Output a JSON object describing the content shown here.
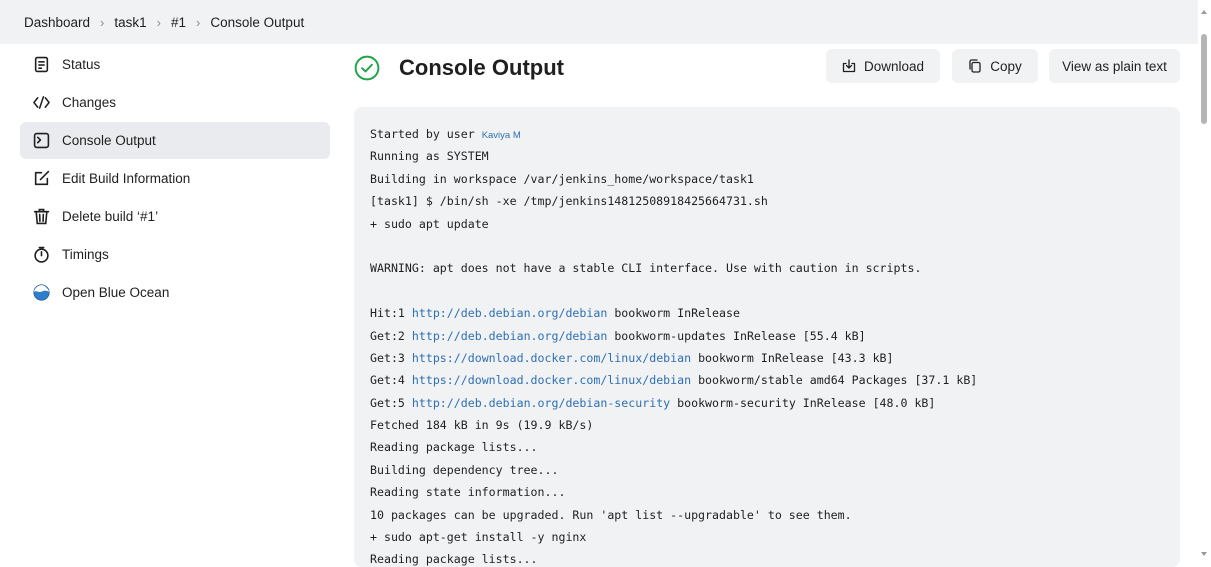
{
  "breadcrumb": {
    "items": [
      "Dashboard",
      "task1",
      "#1",
      "Console Output"
    ],
    "separator": "›"
  },
  "sidebar": {
    "items": [
      {
        "label": "Status",
        "icon": "document-icon"
      },
      {
        "label": "Changes",
        "icon": "code-icon"
      },
      {
        "label": "Console Output",
        "icon": "terminal-icon",
        "active": true
      },
      {
        "label": "Edit Build Information",
        "icon": "edit-icon"
      },
      {
        "label": "Delete build ‘#1’",
        "icon": "trash-icon"
      },
      {
        "label": "Timings",
        "icon": "stopwatch-icon"
      },
      {
        "label": "Open Blue Ocean",
        "icon": "blue-ocean-icon"
      }
    ]
  },
  "header": {
    "title": "Console Output",
    "status_icon": "success-check-icon",
    "download_label": "Download",
    "copy_label": "Copy",
    "plain_text_label": "View as plain text"
  },
  "console": {
    "started_prefix": "Started by user ",
    "started_user": "Kaviya M",
    "line_running": "Running as SYSTEM",
    "line_workspace": "Building in workspace /var/jenkins_home/workspace/task1",
    "line_script": "[task1] $ /bin/sh -xe /tmp/jenkins14812508918425664731.sh",
    "line_apt_update": "+ sudo apt update",
    "line_warning": "WARNING: apt does not have a stable CLI interface. Use with caution in scripts.",
    "hits": [
      {
        "prefix": "Hit:1 ",
        "url": "http://deb.debian.org/debian",
        "suffix": " bookworm InRelease"
      },
      {
        "prefix": "Get:2 ",
        "url": "http://deb.debian.org/debian",
        "suffix": " bookworm-updates InRelease [55.4 kB]"
      },
      {
        "prefix": "Get:3 ",
        "url": "https://download.docker.com/linux/debian",
        "suffix": " bookworm InRelease [43.3 kB]"
      },
      {
        "prefix": "Get:4 ",
        "url": "https://download.docker.com/linux/debian",
        "suffix": " bookworm/stable amd64 Packages [37.1 kB]"
      },
      {
        "prefix": "Get:5 ",
        "url": "http://deb.debian.org/debian-security",
        "suffix": " bookworm-security InRelease [48.0 kB]"
      }
    ],
    "tail_lines": [
      "Fetched 184 kB in 9s (19.9 kB/s)",
      "Reading package lists...",
      "Building dependency tree...",
      "Reading state information...",
      "10 packages can be upgraded. Run 'apt list --upgradable' to see them.",
      "+ sudo apt-get install -y nginx",
      "Reading package lists..."
    ]
  },
  "colors": {
    "success": "#1ea446",
    "link": "#2f6fb3",
    "panel_bg": "#f1f2f4",
    "active_bg": "#e9ebee",
    "blue_ocean": "#2f7ecb"
  }
}
